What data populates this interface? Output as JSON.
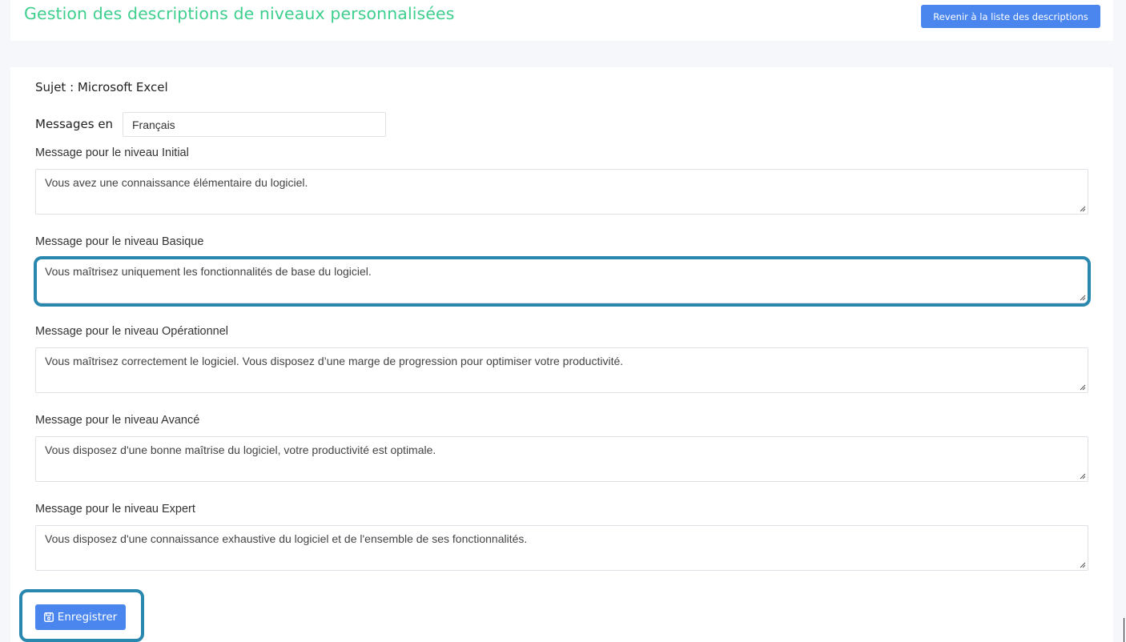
{
  "header": {
    "title": "Gestion des descriptions de niveaux personnalisées",
    "back_button_label": "Revenir à la liste des descriptions"
  },
  "form": {
    "subject": "Sujet : Microsoft Excel",
    "language_label": "Messages en",
    "language_value": "Français",
    "fields": [
      {
        "label": "Message pour le niveau Initial",
        "value": "Vous avez une connaissance élémentaire du logiciel."
      },
      {
        "label": "Message pour le niveau Basique",
        "value": "Vous maîtrisez uniquement les fonctionnalités de base du logiciel."
      },
      {
        "label": "Message pour le niveau Opérationnel",
        "value": "Vous maîtrisez correctement le logiciel. Vous disposez d’une marge de progression pour optimiser votre productivité."
      },
      {
        "label": "Message pour le niveau Avancé",
        "value": "Vous disposez d'une bonne maîtrise du logiciel, votre productivité est optimale."
      },
      {
        "label": "Message pour le niveau Expert",
        "value": "Vous disposez d'une connaissance exhaustive du logiciel et de l'ensemble de ses fonctionnalités."
      }
    ],
    "save_label": "Enregistrer"
  },
  "icons": {
    "save": "floppy-disk-icon",
    "resize": "resize-grip-icon"
  },
  "colors": {
    "title": "#3ecf8e",
    "button": "#4a86ee",
    "highlight": "#2a87ad",
    "background": "#f6f7fb"
  }
}
